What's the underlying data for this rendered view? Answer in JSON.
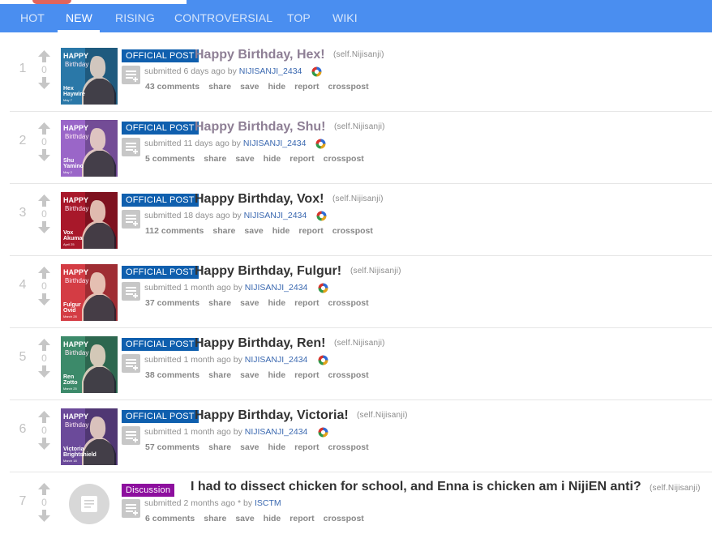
{
  "nav": {
    "tabs": [
      {
        "label": "HOT",
        "active": false
      },
      {
        "label": "NEW",
        "active": true
      },
      {
        "label": "RISING",
        "active": false
      },
      {
        "label": "CONTROVERSIAL",
        "active": false
      },
      {
        "label": "TOP",
        "active": false
      },
      {
        "label": "WIKI",
        "active": false
      }
    ]
  },
  "colors": {
    "nav_bg": "#4a8ef0",
    "flair_official": "#0f5fae",
    "flair_discussion": "#8d0f9e",
    "title_visited": "#8e7f95",
    "title_unvisited": "#333333",
    "author": "#3a68b0"
  },
  "posts": [
    {
      "rank": "1",
      "score": "0",
      "flair": "OFFICIAL POST",
      "title": "Happy Birthday, Hex!",
      "domain": "(self.Nijisanji)",
      "tagline_prefix": "submitted 6 days ago by",
      "author": "NIJISANJI_2434",
      "comments": "43 comments",
      "share": "share",
      "save": "save",
      "hide": "hide",
      "report": "report",
      "crosspost": "crosspost",
      "thumb": {
        "top": "HAPPY",
        "mid": "Birthday",
        "name1": "Hex",
        "name2": "Haywire",
        "date": "May 7",
        "bg": "#2a78a8"
      }
    },
    {
      "rank": "2",
      "score": "0",
      "flair": "OFFICIAL POST",
      "title": "Happy Birthday, Shu!",
      "domain": "(self.Nijisanji)",
      "tagline_prefix": "submitted 11 days ago by",
      "author": "NIJISANJI_2434",
      "comments": "5 comments",
      "share": "share",
      "save": "save",
      "hide": "hide",
      "report": "report",
      "crosspost": "crosspost",
      "thumb": {
        "top": "HAPPY",
        "mid": "Birthday",
        "name1": "Shu",
        "name2": "Yamino",
        "date": "May 2",
        "bg": "#9a66c8"
      }
    },
    {
      "rank": "3",
      "score": "0",
      "flair": "OFFICIAL POST",
      "title": "Happy Birthday, Vox!",
      "domain": "(self.Nijisanji)",
      "tagline_prefix": "submitted 18 days ago by",
      "author": "NIJISANJI_2434",
      "comments": "112 comments",
      "share": "share",
      "save": "save",
      "hide": "hide",
      "report": "report",
      "crosspost": "crosspost",
      "thumb": {
        "top": "HAPPY",
        "mid": "Birthday",
        "name1": "Vox",
        "name2": "Akuma",
        "date": "April 25",
        "bg": "#a8182a"
      }
    },
    {
      "rank": "4",
      "score": "0",
      "flair": "OFFICIAL POST",
      "title": "Happy Birthday, Fulgur!",
      "domain": "(self.Nijisanji)",
      "tagline_prefix": "submitted 1 month ago by",
      "author": "NIJISANJI_2434",
      "comments": "37 comments",
      "share": "share",
      "save": "save",
      "hide": "hide",
      "report": "report",
      "crosspost": "crosspost",
      "thumb": {
        "top": "HAPPY",
        "mid": "Birthday",
        "name1": "Fulgur",
        "name2": "Ovid",
        "date": "March 28",
        "bg": "#d43c44"
      }
    },
    {
      "rank": "5",
      "score": "0",
      "flair": "OFFICIAL POST",
      "title": "Happy Birthday, Ren!",
      "domain": "(self.Nijisanji)",
      "tagline_prefix": "submitted 1 month ago by",
      "author": "NIJISANJI_2434",
      "comments": "38 comments",
      "share": "share",
      "save": "save",
      "hide": "hide",
      "report": "report",
      "crosspost": "crosspost",
      "thumb": {
        "top": "HAPPY",
        "mid": "Birthday",
        "name1": "Ren",
        "name2": "Zotto",
        "date": "March 25",
        "bg": "#3c8a6a"
      }
    },
    {
      "rank": "6",
      "score": "0",
      "flair": "OFFICIAL POST",
      "title": "Happy Birthday, Victoria!",
      "domain": "(self.Nijisanji)",
      "tagline_prefix": "submitted 1 month ago by",
      "author": "NIJISANJI_2434",
      "comments": "57 comments",
      "share": "share",
      "save": "save",
      "hide": "hide",
      "report": "report",
      "crosspost": "crosspost",
      "thumb": {
        "top": "HAPPY",
        "mid": "Birthday",
        "name1": "Victoria",
        "name2": "Brightshield",
        "date": "March 18",
        "bg": "#6b4a9a"
      }
    },
    {
      "rank": "7",
      "score": "0",
      "flair": "Discussion",
      "title": "I had to dissect chicken for school, and Enna is chicken am i NijiEN anti?",
      "domain": "(self.Nijisanji)",
      "tagline_prefix": "submitted 2 months ago * by",
      "author": "ISCTM",
      "comments": "6 comments",
      "share": "share",
      "save": "save",
      "hide": "hide",
      "report": "report",
      "crosspost": "crosspost",
      "thumb": null
    }
  ]
}
